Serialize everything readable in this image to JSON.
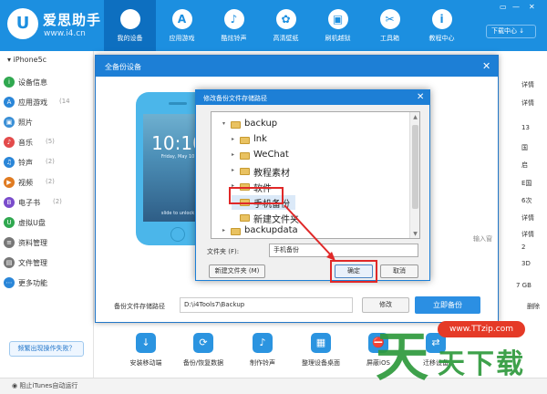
{
  "app": {
    "logo_glyph": "U",
    "name": "爱思助手",
    "url": "www.i4.cn",
    "download_center": "下载中心 ↓",
    "window_controls": [
      "▭",
      "—",
      "✕"
    ]
  },
  "nav": [
    {
      "label": "我的设备",
      "icon": "",
      "icon_name": "apple-icon",
      "active": true
    },
    {
      "label": "应用游戏",
      "icon": "A",
      "icon_name": "app-store-icon"
    },
    {
      "label": "酷炫铃声",
      "icon": "♪",
      "icon_name": "bell-icon"
    },
    {
      "label": "高清壁纸",
      "icon": "✿",
      "icon_name": "flower-icon"
    },
    {
      "label": "刷机越狱",
      "icon": "▣",
      "icon_name": "box-icon"
    },
    {
      "label": "工具箱",
      "icon": "✂",
      "icon_name": "tools-icon"
    },
    {
      "label": "教程中心",
      "icon": "i",
      "icon_name": "info-icon"
    }
  ],
  "sidebar": {
    "device": "▾ iPhone5c",
    "items": [
      {
        "label": "设备信息",
        "count": "",
        "color": "#2fa84f",
        "icon": "i"
      },
      {
        "label": "应用游戏",
        "count": "(14",
        "color": "#2a86d8",
        "icon": "A"
      },
      {
        "label": "照片",
        "count": "",
        "color": "#3a8fd6",
        "icon": "▣"
      },
      {
        "label": "音乐",
        "count": "(5)",
        "color": "#e34b4b",
        "icon": "♪"
      },
      {
        "label": "铃声",
        "count": "(2)",
        "color": "#2a86d8",
        "icon": "♫"
      },
      {
        "label": "视频",
        "count": "(2)",
        "color": "#e07b21",
        "icon": "▶"
      },
      {
        "label": "电子书",
        "count": "(2)",
        "color": "#7a4ccb",
        "icon": "B"
      },
      {
        "label": "虚拟U盘",
        "count": "",
        "color": "#2fa84f",
        "icon": "U"
      },
      {
        "label": "资料管理",
        "count": "",
        "color": "#777777",
        "icon": "≡"
      },
      {
        "label": "文件管理",
        "count": "",
        "color": "#777777",
        "icon": "▤"
      },
      {
        "label": "更多功能",
        "count": "",
        "color": "#2a86d8",
        "icon": "⋯"
      }
    ],
    "fail_button": "频繁出现操作失败？"
  },
  "status": {
    "itunes": "◉ 阻止iTunes自动运行"
  },
  "bottom_tools": [
    {
      "label": "安装移动端",
      "icon": "↓"
    },
    {
      "label": "备份/恢复数据",
      "icon": "⟳"
    },
    {
      "label": "制作铃声",
      "icon": "♪"
    },
    {
      "label": "整理设备桌面",
      "icon": "▦"
    },
    {
      "label": "屏蔽iOS",
      "icon": "⛔"
    },
    {
      "label": "迁移设备",
      "icon": "⇄"
    }
  ],
  "right_peek": [
    "详情",
    "详情",
    "13",
    "国",
    "启",
    "E国",
    "6次",
    "详情",
    "详情",
    "2",
    "3D",
    "7 GB",
    "删除"
  ],
  "main_dialog": {
    "title": "全备份设备",
    "close": "✕",
    "phone": {
      "time": "10:10",
      "date": "Friday, May 10",
      "slide": "slide to unlock"
    },
    "path_label": "备份文件存储路径",
    "path_value": "D:\\i4Tools7\\Backup",
    "modify": "修改",
    "backup_now": "立即备份",
    "right_hint": "输入窗"
  },
  "folder_dialog": {
    "title": "修改备份文件存储路径",
    "close": "✕",
    "tree": [
      {
        "label": "backup",
        "expander": "▾",
        "level": 0
      },
      {
        "label": "lnk",
        "expander": "▸",
        "level": 1
      },
      {
        "label": "WeChat",
        "expander": "▸",
        "level": 1
      },
      {
        "label": "教程素材",
        "expander": "▸",
        "level": 1
      },
      {
        "label": "软件",
        "expander": "▸",
        "level": 1
      },
      {
        "label": "手机备份",
        "expander": "",
        "level": 1,
        "selected": true
      },
      {
        "label": "新建文件夹",
        "expander": "",
        "level": 1
      },
      {
        "label": "backupdata",
        "expander": "▸",
        "level": 0
      }
    ],
    "folder_label": "文件夹 (F):",
    "folder_value": "手机备份",
    "new_folder": "新建文件夹 (M)",
    "ok": "确定",
    "cancel": "取消"
  },
  "watermark": {
    "badge": "www.TTzip.com",
    "big": "天",
    "text": "天下载"
  },
  "accent": "#1c8fe0",
  "highlight": "#e02828"
}
